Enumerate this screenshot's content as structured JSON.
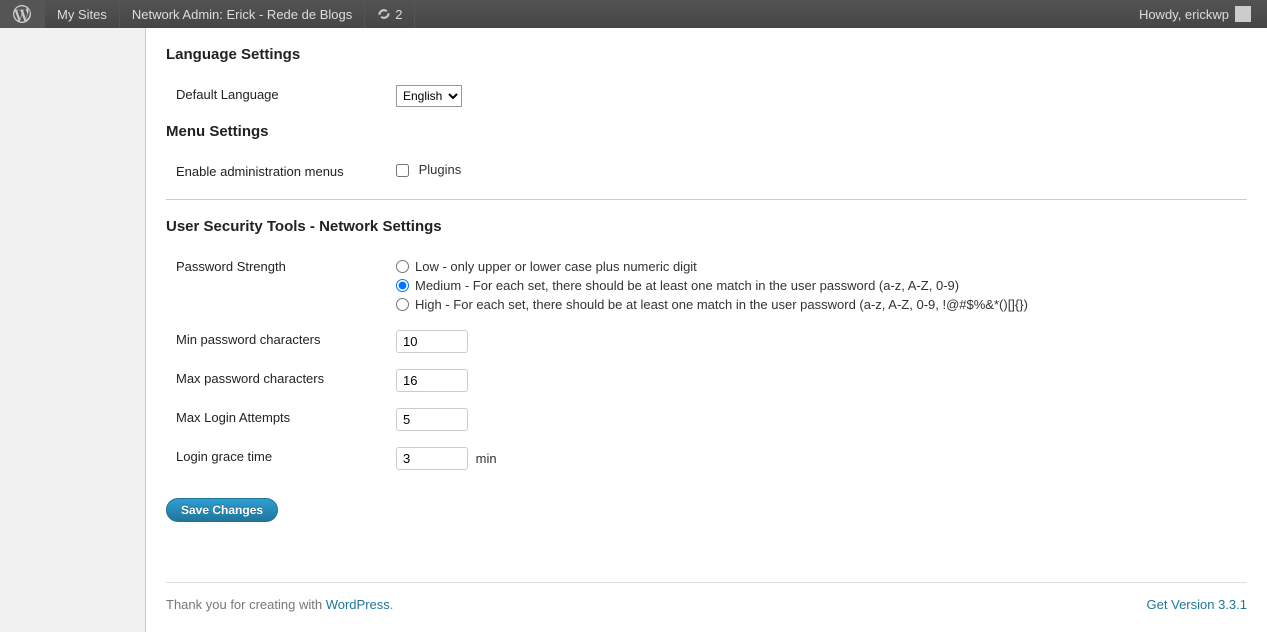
{
  "adminbar": {
    "my_sites": "My Sites",
    "network_admin": "Network Admin: Erick - Rede de Blogs",
    "refresh_count": "2",
    "howdy": "Howdy, erickwp"
  },
  "sections": {
    "language": {
      "title": "Language Settings",
      "default_language_label": "Default Language",
      "default_language_value": "English"
    },
    "menu": {
      "title": "Menu Settings",
      "enable_admin_menus_label": "Enable administration menus",
      "plugins_label": "Plugins"
    },
    "security": {
      "title": "User Security Tools - Network Settings",
      "password_strength_label": "Password Strength",
      "strength_options": {
        "low": "Low - only upper or lower case plus numeric digit",
        "medium": "Medium - For each set, there should be at least one match in the user password (a-z, A-Z, 0-9)",
        "high": "High - For each set, there should be at least one match in the user password (a-z, A-Z, 0-9, !@#$%&*()[]{})"
      },
      "min_pw_label": "Min password characters",
      "min_pw_value": "10",
      "max_pw_label": "Max password characters",
      "max_pw_value": "16",
      "max_login_label": "Max Login Attempts",
      "max_login_value": "5",
      "grace_label": "Login grace time",
      "grace_value": "3",
      "grace_unit": "min"
    }
  },
  "buttons": {
    "save": "Save Changes"
  },
  "footer": {
    "thank_you_prefix": "Thank you for creating with ",
    "wordpress": "WordPress",
    "period": ".",
    "version": "Get Version 3.3.1"
  }
}
